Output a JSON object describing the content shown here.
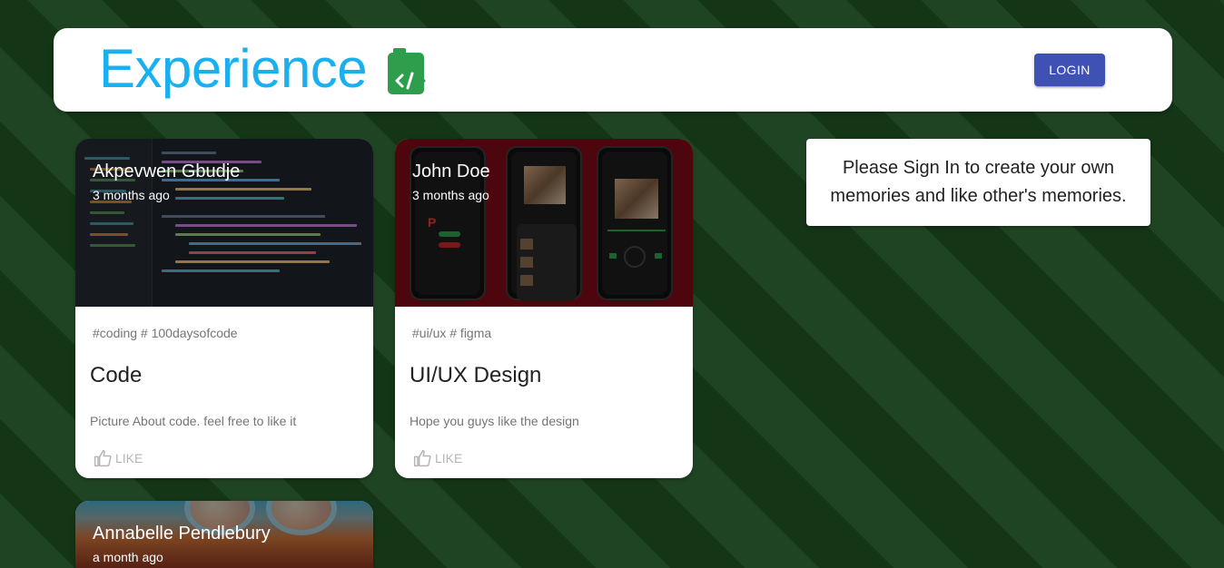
{
  "app": {
    "title": "Experience",
    "brand_color": "#1ab0f0",
    "logo_icon": "code-clipboard-icon",
    "login_label": "LOGIN",
    "login_color": "#3f51b5"
  },
  "posts": [
    {
      "author": "Akpevwen Gbudje",
      "created": "3 months ago",
      "tags": "#coding # 100daysofcode",
      "title": "Code",
      "message": "Picture About code. feel free to like it",
      "like_label": "LIKE"
    },
    {
      "author": "John Doe",
      "created": "3 months ago",
      "tags": "#ui/ux # figma",
      "title": "UI/UX Design",
      "message": "Hope you guys like the design",
      "like_label": "LIKE"
    },
    {
      "author": "Annabelle Pendlebury",
      "created": "a month ago"
    }
  ],
  "signin": {
    "message": "Please Sign In to create your own memories and like other's memories."
  }
}
